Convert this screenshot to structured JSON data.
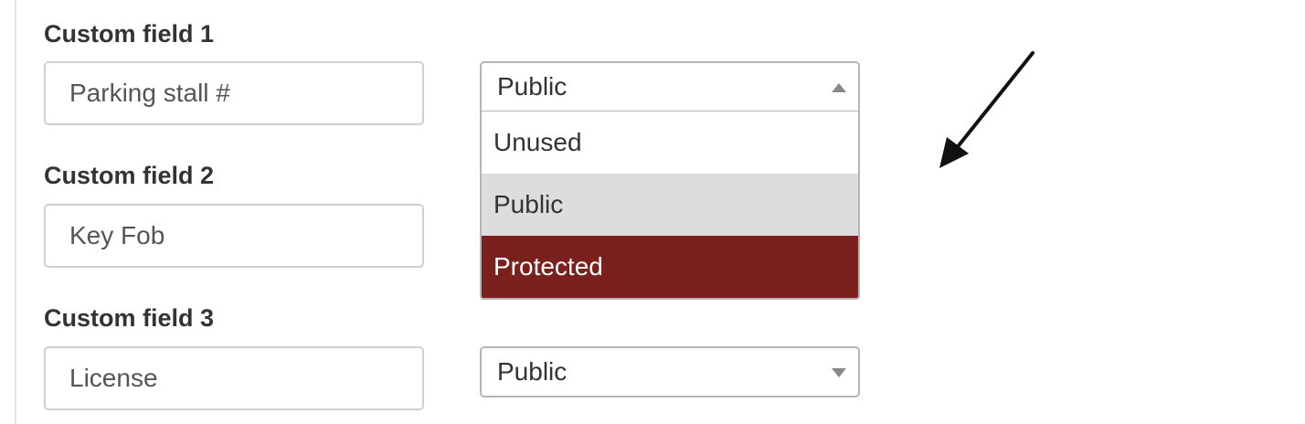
{
  "fields": [
    {
      "label": "Custom field 1",
      "value": "Parking stall #",
      "visibility": "Public"
    },
    {
      "label": "Custom field 2",
      "value": "Key Fob"
    },
    {
      "label": "Custom field 3",
      "value": "License",
      "visibility": "Public"
    }
  ],
  "dropdown": {
    "open": true,
    "options": [
      "Unused",
      "Public",
      "Protected"
    ],
    "selected": "Public",
    "highlighted": "Protected"
  },
  "colors": {
    "highlight": "#7b211d",
    "selected_bg": "#dddddd",
    "label_text": "#333333"
  },
  "annotation": {
    "arrow_icon": "arrow-down-left-icon"
  }
}
